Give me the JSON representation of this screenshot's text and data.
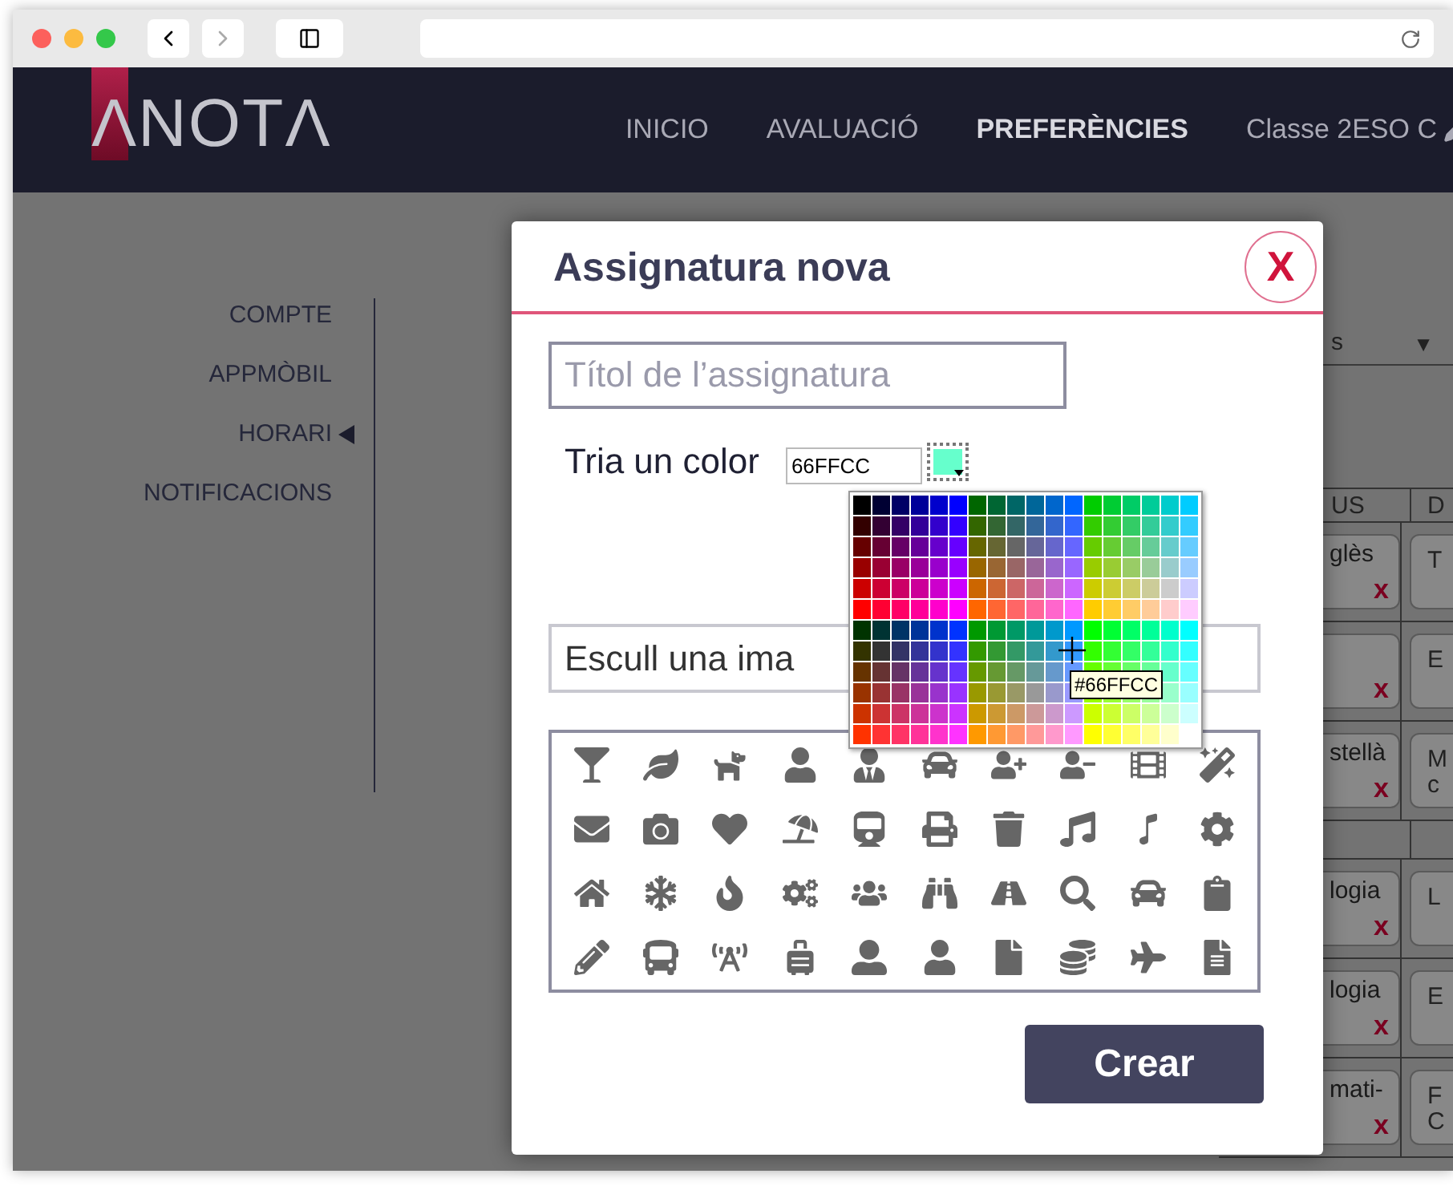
{
  "nav": {
    "logo": "ΛNOTΛ",
    "links": [
      {
        "label": "INICIO",
        "selected": false
      },
      {
        "label": "AVALUACIÓ",
        "selected": false
      },
      {
        "label": "PREFERÈNCIES",
        "selected": true
      }
    ],
    "class_label": "Classe 2ESO C"
  },
  "sidebar": {
    "items": [
      {
        "label": "COMPTE",
        "selected": false
      },
      {
        "label": "APPMÒBIL",
        "selected": false
      },
      {
        "label": "HORARI",
        "selected": true
      },
      {
        "label": "NOTIFICACIONS",
        "selected": false
      }
    ]
  },
  "schedule": {
    "dropdown": {
      "value": "s",
      "arrow": "▼"
    },
    "columns": [
      "US",
      "D"
    ],
    "rows": [
      {
        "kind": "lesson",
        "cells": [
          {
            "text": "glès",
            "remove": "x"
          },
          {
            "lines": [
              "T"
            ]
          }
        ]
      },
      {
        "kind": "lesson",
        "cells": [
          {
            "remove": "x"
          },
          {
            "lines": [
              "E"
            ]
          }
        ]
      },
      {
        "kind": "lesson",
        "cells": [
          {
            "text": "stellà",
            "remove": "x"
          },
          {
            "lines": [
              "M",
              "c"
            ]
          }
        ]
      },
      {
        "kind": "break"
      },
      {
        "kind": "lesson",
        "cells": [
          {
            "text": "logia",
            "remove": "x"
          },
          {
            "lines": [
              "L"
            ]
          }
        ]
      },
      {
        "kind": "lesson",
        "cells": [
          {
            "text": "logia",
            "remove": "x"
          },
          {
            "lines": [
              "E"
            ]
          }
        ]
      },
      {
        "kind": "lesson",
        "cells": [
          {
            "text": "mati-",
            "remove": "x"
          },
          {
            "lines": [
              "F",
              "C"
            ]
          }
        ]
      }
    ]
  },
  "dialog": {
    "title": "Assignatura nova",
    "close": "X",
    "title_placeholder": "Títol de l’assignatura",
    "color_label": "Tria un color",
    "color_picker": {
      "value": "66FFCC",
      "color": "#66ffcc",
      "tooltip": "#66FFCC"
    },
    "image_placeholder": "Escull una ima",
    "create_button": "Crear"
  }
}
